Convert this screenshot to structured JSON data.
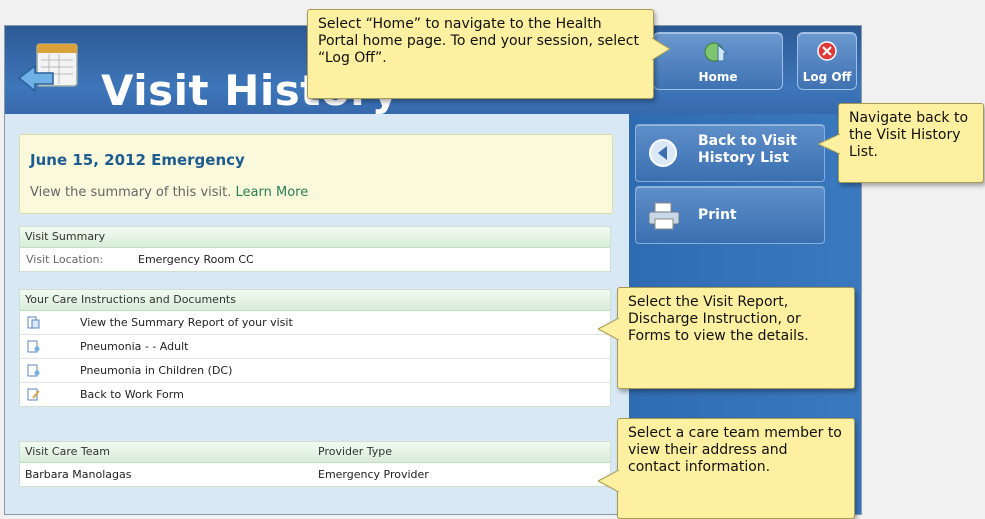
{
  "header": {
    "title": "Visit History",
    "home_label": "Home",
    "logoff_label": "Log Off"
  },
  "visit": {
    "title": "June 15, 2012 Emergency",
    "description": "View the summary of this visit.",
    "learn_more": "Learn More"
  },
  "summary": {
    "header": "Visit Summary",
    "location_label": "Visit Location:",
    "location_value": "Emergency Room CC"
  },
  "instructions": {
    "header": "Your Care Instructions and Documents",
    "items": [
      {
        "label": "View the Summary Report of your visit",
        "icon": "report-icon"
      },
      {
        "label": "Pneumonia - - Adult",
        "icon": "document-icon"
      },
      {
        "label": "Pneumonia in Children (DC)",
        "icon": "document-icon"
      },
      {
        "label": "Back to Work Form",
        "icon": "form-icon"
      }
    ]
  },
  "care_team": {
    "header_name": "Visit Care Team",
    "header_type": "Provider Type",
    "rows": [
      {
        "name": "Barbara Manolagas",
        "type": "Emergency Provider"
      }
    ]
  },
  "sidebar": {
    "back_label_line1": "Back to Visit",
    "back_label_line2": "History List",
    "print_label": "Print"
  },
  "callouts": {
    "home": "Select “Home” to navigate to the Health Portal home page. To end your session, select “Log Off”.",
    "back": "Navigate back to the Visit History List.",
    "docs": "Select the Visit Report, Discharge Instruction, or Forms to view the details.",
    "team": "Select a care team member to view their address and contact information."
  },
  "colors": {
    "header_blue": "#3e76ba",
    "callout_yellow": "#fdf0a0",
    "visit_title": "#1e5b91",
    "link_green": "#2a7f55"
  }
}
